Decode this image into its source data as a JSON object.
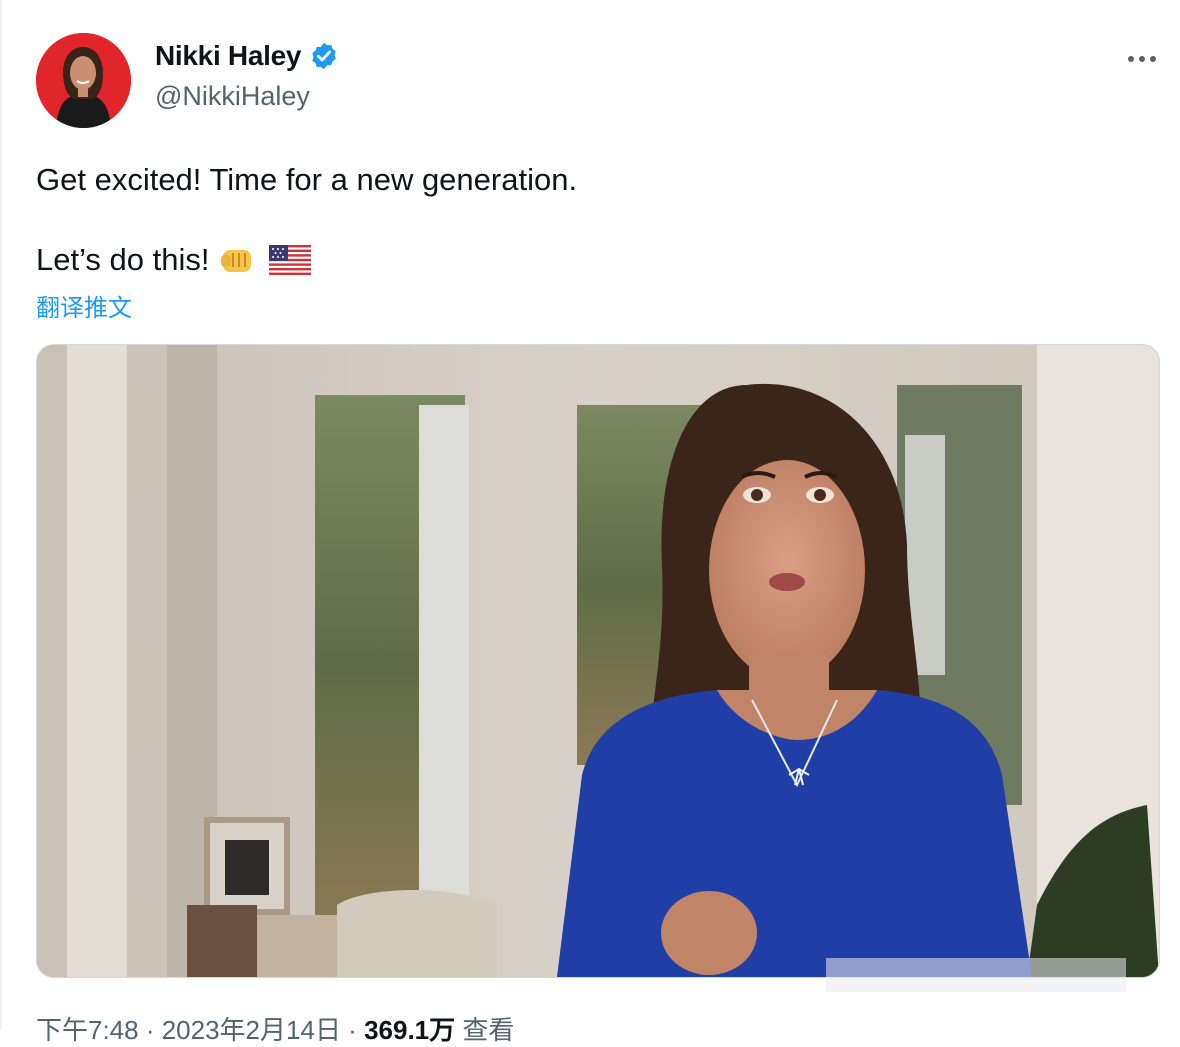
{
  "tweet": {
    "author": {
      "display_name": "Nikki Haley",
      "handle": "@NikkiHaley",
      "verified": true,
      "avatar_bg": "#e0262b"
    },
    "text_line1": "Get excited! Time for a new generation.",
    "text_line2": "Let’s do this!",
    "emojis": [
      "oncoming-fist",
      "us-flag"
    ],
    "translate_label": "翻译推文",
    "more_icon": "more-horizontal-icon",
    "media": {
      "type": "video-still",
      "description_icon": "video-thumbnail"
    },
    "meta": {
      "time": "下午7:48",
      "sep1": " · ",
      "date": "2023年2月14日",
      "sep2": " · ",
      "views_count": "369.1万",
      "views_label": " 查看"
    }
  },
  "colors": {
    "accent": "#1d9bf0",
    "secondary_text": "#536471",
    "verified": "#1d9bf0"
  }
}
